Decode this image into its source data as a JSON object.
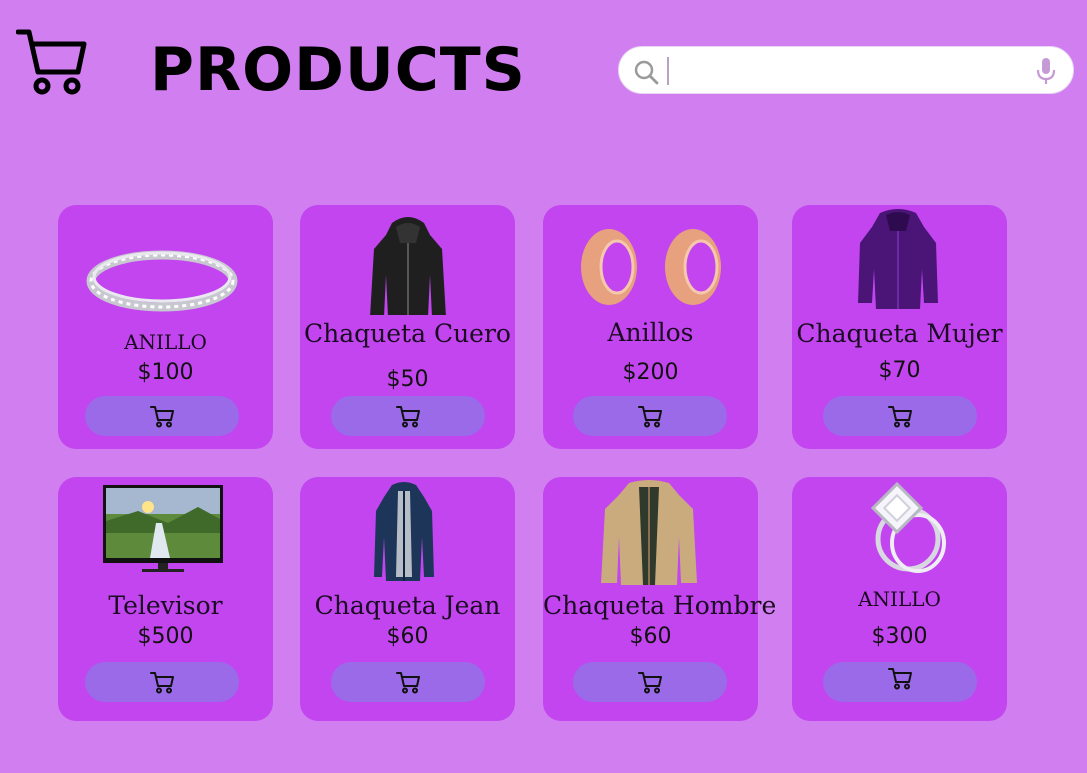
{
  "header": {
    "logo_icon": "shopping-cart-icon",
    "title": "PRODUCTS"
  },
  "search": {
    "placeholder": "",
    "value": "",
    "search_icon": "search-icon",
    "mic_icon": "microphone-icon"
  },
  "colors": {
    "background": "#d17ef0",
    "card": "#c245ef",
    "button": "#9a6ae9"
  },
  "products": [
    {
      "name": "ANILLO",
      "price": "$100",
      "image": "silver-diamond-band-ring",
      "button_icon": "add-to-cart-icon"
    },
    {
      "name": "Chaqueta Cuero",
      "price": "$50",
      "image": "black-leather-hooded-jacket",
      "button_icon": "add-to-cart-icon"
    },
    {
      "name": "Anillos",
      "price": "$200",
      "image": "rose-gold-ear-tunnels",
      "button_icon": "add-to-cart-icon"
    },
    {
      "name": "Chaqueta Mujer",
      "price": "$70",
      "image": "purple-womens-jacket",
      "button_icon": "add-to-cart-icon"
    },
    {
      "name": "Televisor",
      "price": "$500",
      "image": "tv-monitor-waterfall-landscape",
      "button_icon": "add-to-cart-icon"
    },
    {
      "name": "Chaqueta Jean",
      "price": "$60",
      "image": "navy-blue-coat",
      "button_icon": "add-to-cart-icon"
    },
    {
      "name": "Chaqueta Hombre",
      "price": "$60",
      "image": "beige-mens-jacket",
      "button_icon": "add-to-cart-icon"
    },
    {
      "name": "ANILLO",
      "price": "$300",
      "image": "diamond-engagement-ring-set",
      "button_icon": "add-to-cart-icon"
    }
  ]
}
